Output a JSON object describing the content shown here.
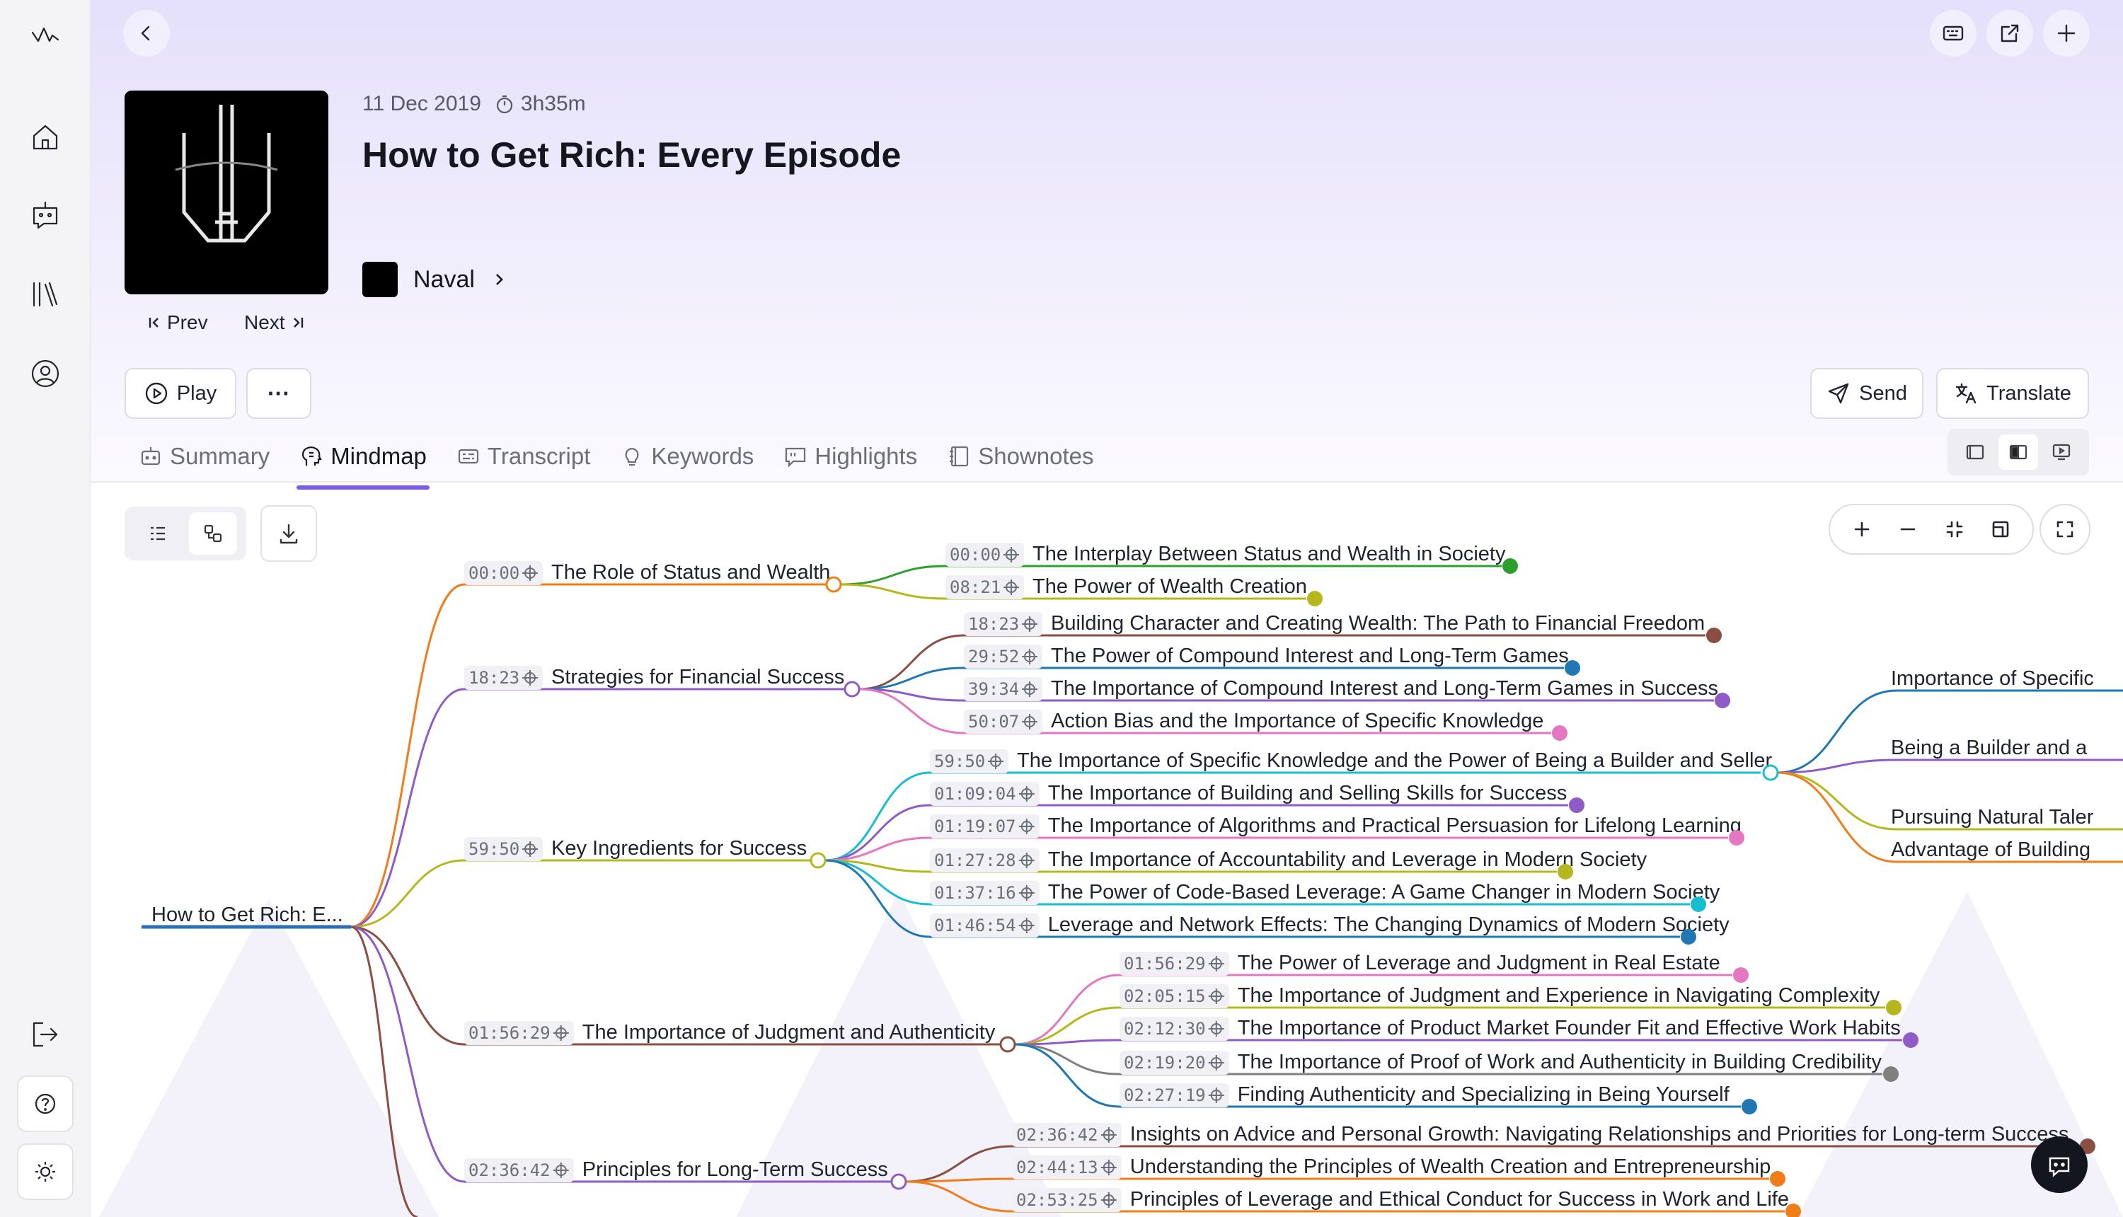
{
  "sidebar": {
    "logo": "wave-logo-icon",
    "items": [
      {
        "name": "home",
        "icon": "home-icon"
      },
      {
        "name": "assistant",
        "icon": "robot-chat-icon"
      },
      {
        "name": "library",
        "icon": "library-icon"
      },
      {
        "name": "account",
        "icon": "user-circle-icon"
      }
    ],
    "bottom": [
      {
        "name": "logout",
        "icon": "logout-icon"
      },
      {
        "name": "help",
        "icon": "help-icon"
      },
      {
        "name": "theme",
        "icon": "sun-icon"
      }
    ]
  },
  "episode": {
    "date": "11 Dec 2019",
    "duration": "3h35m",
    "title": "How to Get Rich: Every Episode",
    "author": "Naval",
    "prev_label": "Prev",
    "next_label": "Next"
  },
  "actions": {
    "play_label": "Play",
    "more_label": "···",
    "send_label": "Send",
    "translate_label": "Translate"
  },
  "tabs": [
    {
      "label": "Summary",
      "icon": "robot-icon",
      "active": false
    },
    {
      "label": "Mindmap",
      "icon": "brain-icon",
      "active": true
    },
    {
      "label": "Transcript",
      "icon": "caption-icon",
      "active": false
    },
    {
      "label": "Keywords",
      "icon": "bulb-icon",
      "active": false
    },
    {
      "label": "Highlights",
      "icon": "quote-icon",
      "active": false
    },
    {
      "label": "Shownotes",
      "icon": "notebook-icon",
      "active": false
    }
  ],
  "colors": {
    "accent": "#7a5be6",
    "root": "#2a6fb5",
    "orange": "#f07c1a",
    "purple": "#8e5bc7",
    "olive": "#b4b81e",
    "brown": "#8b4e43",
    "green": "#2ca02c",
    "blue": "#1f77b4",
    "pink": "#e377c2",
    "cyan": "#17becf",
    "gray": "#7f7f7f"
  },
  "mindmap": {
    "root": {
      "label": "How to Get Rich: E..."
    },
    "branches": [
      {
        "time": "00:00",
        "label": "The Role of Status and Wealth",
        "color": "#f07c1a",
        "children": [
          {
            "time": "00:00",
            "label": "The Interplay Between Status and Wealth in Society",
            "color": "#2ca02c"
          },
          {
            "time": "08:21",
            "label": "The Power of Wealth Creation",
            "color": "#b4b81e"
          }
        ]
      },
      {
        "time": "18:23",
        "label": "Strategies for Financial Success",
        "color": "#8e5bc7",
        "children": [
          {
            "time": "18:23",
            "label": "Building Character and Creating Wealth: The Path to Financial Freedom",
            "color": "#8b4e43"
          },
          {
            "time": "29:52",
            "label": "The Power of Compound Interest and Long-Term Games",
            "color": "#1f77b4"
          },
          {
            "time": "39:34",
            "label": "The Importance of Compound Interest and Long-Term Games in Success",
            "color": "#8e5bc7"
          },
          {
            "time": "50:07",
            "label": "Action Bias and the Importance of Specific Knowledge",
            "color": "#e377c2"
          }
        ]
      },
      {
        "time": "59:50",
        "label": "Key Ingredients for Success",
        "color": "#b4b81e",
        "children": [
          {
            "time": "59:50",
            "label": "The Importance of Specific Knowledge and the Power of Being a Builder and Seller",
            "color": "#17becf",
            "children": [
              {
                "label": "Importance of Specific",
                "color": "#1f77b4"
              },
              {
                "label": "Being a Builder and a",
                "color": "#8e5bc7"
              },
              {
                "label": "Pursuing Natural Taler",
                "color": "#b4b81e"
              },
              {
                "label": "Advantage of Building",
                "color": "#f07c1a"
              }
            ]
          },
          {
            "time": "01:09:04",
            "label": "The Importance of Building and Selling Skills for Success",
            "color": "#8e5bc7"
          },
          {
            "time": "01:19:07",
            "label": "The Importance of Algorithms and Practical Persuasion for Lifelong Learning",
            "color": "#e377c2"
          },
          {
            "time": "01:27:28",
            "label": "The Importance of Accountability and Leverage in Modern Society",
            "color": "#b4b81e"
          },
          {
            "time": "01:37:16",
            "label": "The Power of Code-Based Leverage: A Game Changer in Modern Society",
            "color": "#17becf"
          },
          {
            "time": "01:46:54",
            "label": "Leverage and Network Effects: The Changing Dynamics of Modern Society",
            "color": "#1f77b4"
          }
        ]
      },
      {
        "time": "01:56:29",
        "label": "The Importance of Judgment and Authenticity",
        "color": "#8b4e43",
        "children": [
          {
            "time": "01:56:29",
            "label": "The Power of Leverage and Judgment in Real Estate",
            "color": "#e377c2"
          },
          {
            "time": "02:05:15",
            "label": "The Importance of Judgment and Experience in Navigating Complexity",
            "color": "#b4b81e"
          },
          {
            "time": "02:12:30",
            "label": "The Importance of Product Market Founder Fit and Effective Work Habits",
            "color": "#8e5bc7"
          },
          {
            "time": "02:19:20",
            "label": "The Importance of Proof of Work and Authenticity in Building Credibility",
            "color": "#7f7f7f"
          },
          {
            "time": "02:27:19",
            "label": "Finding Authenticity and Specializing in Being Yourself",
            "color": "#1f77b4"
          }
        ]
      },
      {
        "time": "02:36:42",
        "label": "Principles for Long-Term Success",
        "color": "#8e5bc7",
        "children": [
          {
            "time": "02:36:42",
            "label": "Insights on Advice and Personal Growth: Navigating Relationships and Priorities for Long-term Success",
            "color": "#8b4e43"
          },
          {
            "time": "02:44:13",
            "label": "Understanding the Principles of Wealth Creation and Entrepreneurship",
            "color": "#f07c1a"
          },
          {
            "time": "02:53:25",
            "label": "Principles of Leverage and Ethical Conduct for Success in Work and Life",
            "color": "#f07c1a"
          }
        ]
      }
    ]
  }
}
